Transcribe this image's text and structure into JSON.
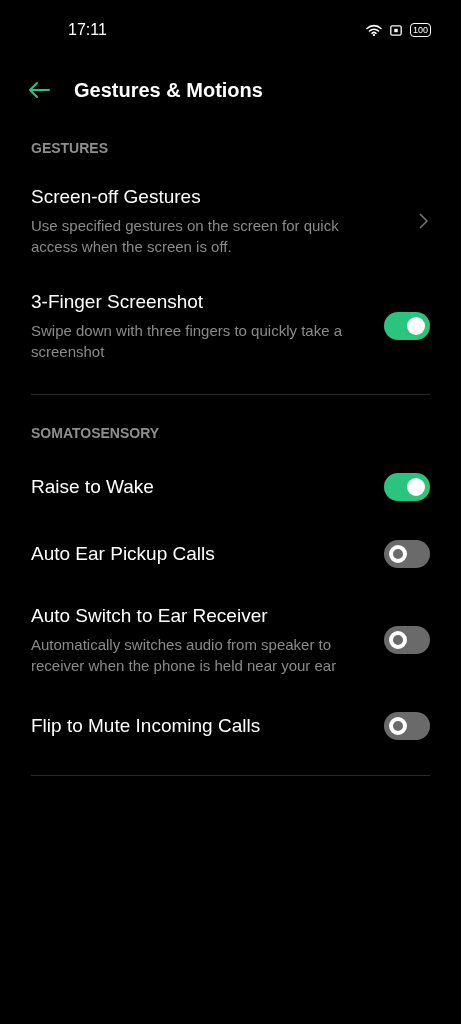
{
  "status_bar": {
    "time": "17:11",
    "battery": "100"
  },
  "header": {
    "title": "Gestures & Motions"
  },
  "sections": [
    {
      "title": "GESTURES",
      "items": [
        {
          "kind": "link",
          "title": "Screen-off Gestures",
          "description": "Use specified gestures on the screen for quick access when the screen is off."
        },
        {
          "kind": "toggle",
          "title": "3-Finger Screenshot",
          "description": "Swipe down with three fingers to quickly take a screenshot",
          "on": true
        }
      ]
    },
    {
      "title": "SOMATOSENSORY",
      "items": [
        {
          "kind": "toggle",
          "title": "Raise to Wake",
          "on": true
        },
        {
          "kind": "toggle",
          "title": "Auto Ear Pickup Calls",
          "on": false
        },
        {
          "kind": "toggle",
          "title": "Auto Switch to Ear Receiver",
          "description": "Automatically switches audio from speaker to receiver when the phone is held near your ear",
          "on": false
        },
        {
          "kind": "toggle",
          "title": "Flip to Mute Incoming Calls",
          "on": false
        }
      ]
    }
  ]
}
